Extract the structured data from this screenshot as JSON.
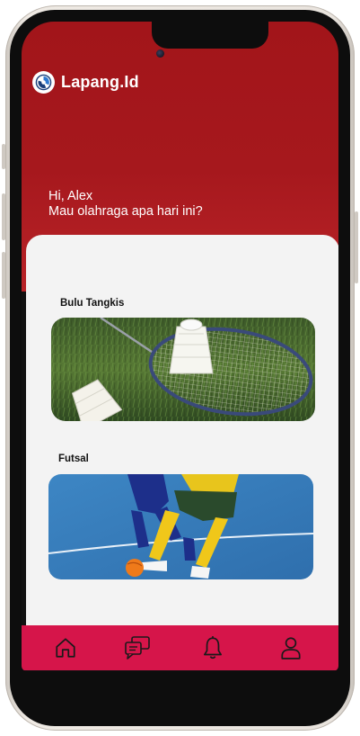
{
  "app": {
    "name": "Lapang.Id"
  },
  "greeting": {
    "line1": "Hi, Alex",
    "line2": "Mau olahraga apa hari ini?"
  },
  "sports": [
    {
      "title": "Bulu Tangkis",
      "image": "badminton-shuttlecock-racket-photo"
    },
    {
      "title": "Futsal",
      "image": "futsal-players-photo"
    }
  ],
  "bottom_nav": [
    {
      "icon": "home-icon"
    },
    {
      "icon": "chat-icon"
    },
    {
      "icon": "bell-icon"
    },
    {
      "icon": "profile-icon"
    }
  ],
  "colors": {
    "header": "#a2151a",
    "nav": "#d6154a",
    "card": "#f3f3f3"
  }
}
